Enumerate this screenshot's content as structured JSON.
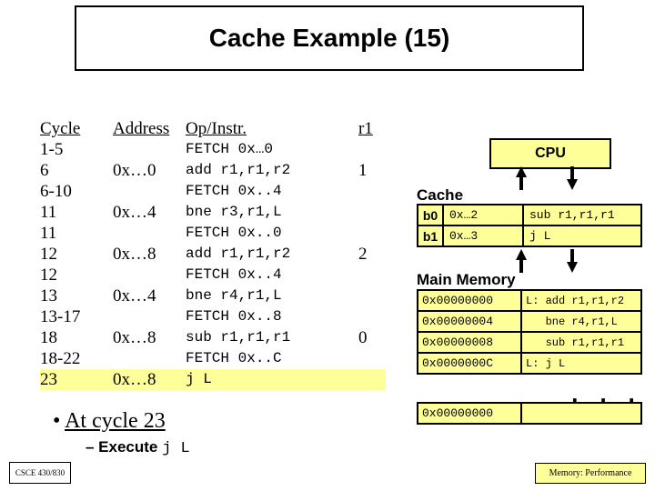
{
  "title": "Cache Example (15)",
  "headers": {
    "c1": "Cycle",
    "c2": "Address",
    "c3": "Op/Instr.",
    "c4": "r1"
  },
  "rows": [
    {
      "c1": "1-5",
      "c2": "",
      "c3": "FETCH 0x…0",
      "c4": ""
    },
    {
      "c1": "6",
      "c2": "0x…0",
      "c3": "add r1,r1,r2",
      "c4": "1"
    },
    {
      "c1": "6-10",
      "c2": "",
      "c3": "FETCH 0x..4",
      "c4": ""
    },
    {
      "c1": "11",
      "c2": "0x…4",
      "c3": "bne r3,r1,L",
      "c4": ""
    },
    {
      "c1": "11",
      "c2": "",
      "c3": "FETCH 0x..0",
      "c4": ""
    },
    {
      "c1": "12",
      "c2": "0x…8",
      "c3": "add r1,r1,r2",
      "c4": "2"
    },
    {
      "c1": "12",
      "c2": "",
      "c3": "FETCH 0x..4",
      "c4": ""
    },
    {
      "c1": "13",
      "c2": "0x…4",
      "c3": "bne r4,r1,L",
      "c4": ""
    },
    {
      "c1": "13-17",
      "c2": "",
      "c3": "FETCH 0x..8",
      "c4": ""
    },
    {
      "c1": "18",
      "c2": "0x…8",
      "c3": "sub r1,r1,r1",
      "c4": "0"
    },
    {
      "c1": "18-22",
      "c2": "",
      "c3": "FETCH 0x..C",
      "c4": ""
    },
    {
      "c1": "23",
      "c2": "0x…8",
      "c3": "j L",
      "c4": ""
    }
  ],
  "bullet": "At cycle 23",
  "sub_prefix": "– Execute ",
  "sub_code": "j L",
  "cpu": "CPU",
  "cache_label": "Cache",
  "cache_rows": [
    {
      "b": "b0",
      "tag": "0x…2",
      "instr": "sub r1,r1,r1"
    },
    {
      "b": "b1",
      "tag": "0x…3",
      "instr": "j L"
    }
  ],
  "mm_label": "Main Memory",
  "mm_rows": [
    {
      "addr": "0x00000000",
      "instr": "L: add r1,r1,r2"
    },
    {
      "addr": "0x00000004",
      "instr": "   bne r4,r1,L"
    },
    {
      "addr": "0x00000008",
      "instr": "   sub r1,r1,r1"
    },
    {
      "addr": "0x0000000C",
      "instr": "L: j L"
    },
    {
      "addr": "",
      "instr": ""
    },
    {
      "addr": "0x00000000",
      "instr": ""
    }
  ],
  "dots": ". . .",
  "foot_left": "CSCE 430/830",
  "foot_right": "Memory: Performance",
  "chart_data": {
    "type": "table",
    "title": "Cache Example (15)",
    "cycle_trace": [
      {
        "cycle": "1-5",
        "address": null,
        "op": "FETCH 0x…0",
        "r1": null
      },
      {
        "cycle": "6",
        "address": "0x…0",
        "op": "add r1,r1,r2",
        "r1": 1
      },
      {
        "cycle": "6-10",
        "address": null,
        "op": "FETCH 0x..4",
        "r1": null
      },
      {
        "cycle": "11",
        "address": "0x…4",
        "op": "bne r3,r1,L",
        "r1": null
      },
      {
        "cycle": "11",
        "address": null,
        "op": "FETCH 0x..0",
        "r1": null
      },
      {
        "cycle": "12",
        "address": "0x…8",
        "op": "add r1,r1,r2",
        "r1": 2
      },
      {
        "cycle": "12",
        "address": null,
        "op": "FETCH 0x..4",
        "r1": null
      },
      {
        "cycle": "13",
        "address": "0x…4",
        "op": "bne r4,r1,L",
        "r1": null
      },
      {
        "cycle": "13-17",
        "address": null,
        "op": "FETCH 0x..8",
        "r1": null
      },
      {
        "cycle": "18",
        "address": "0x…8",
        "op": "sub r1,r1,r1",
        "r1": 0
      },
      {
        "cycle": "18-22",
        "address": null,
        "op": "FETCH 0x..C",
        "r1": null
      },
      {
        "cycle": "23",
        "address": "0x…8",
        "op": "j L",
        "r1": null
      }
    ],
    "cache": [
      {
        "block": "b0",
        "tag": "0x…2",
        "instr": "sub r1,r1,r1"
      },
      {
        "block": "b1",
        "tag": "0x…3",
        "instr": "j L"
      }
    ],
    "main_memory": [
      {
        "addr": "0x00000000",
        "instr": "L: add r1,r1,r2"
      },
      {
        "addr": "0x00000004",
        "instr": "bne r4,r1,L"
      },
      {
        "addr": "0x00000008",
        "instr": "sub r1,r1,r1"
      },
      {
        "addr": "0x0000000C",
        "instr": "L: j L"
      },
      {
        "addr": "0x00000000",
        "instr": ""
      }
    ]
  }
}
